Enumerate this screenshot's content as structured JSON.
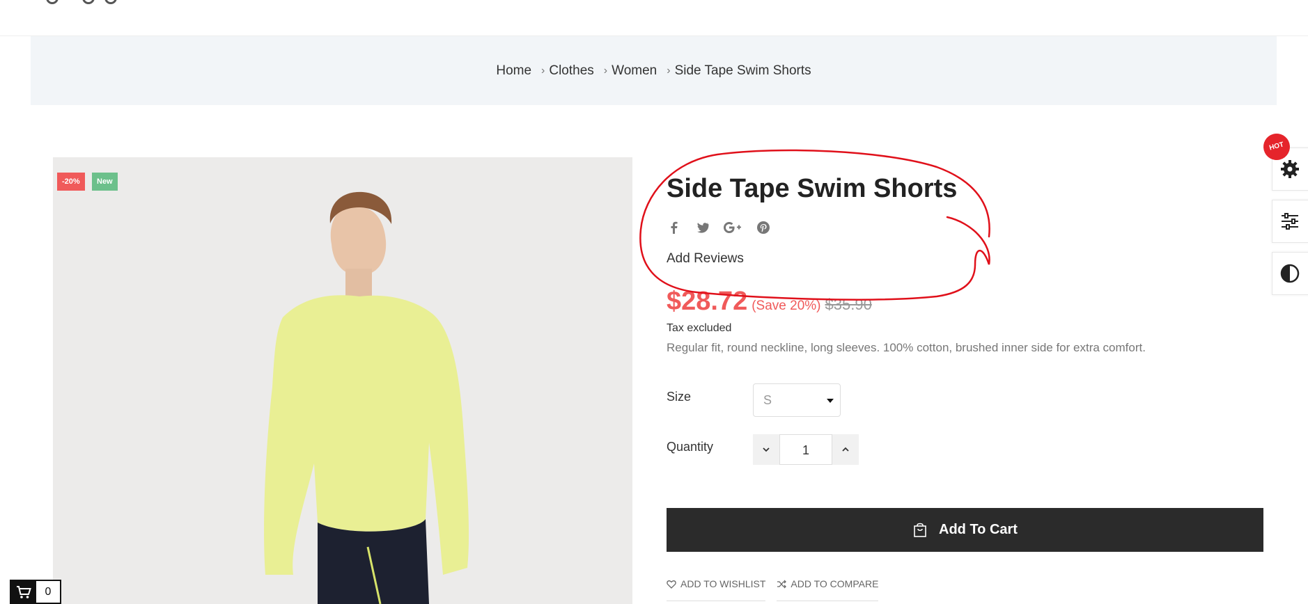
{
  "breadcrumb": {
    "items": [
      "Home",
      "Clothes",
      "Women",
      "Side Tape Swim Shorts"
    ],
    "separator": "›"
  },
  "product": {
    "badges": {
      "sale": "-20%",
      "new": "New"
    },
    "title": "Side Tape Swim Shorts",
    "social_icons": [
      "facebook-icon",
      "twitter-icon",
      "google-plus-icon",
      "pinterest-icon"
    ],
    "add_reviews": "Add Reviews",
    "price": "$28.72",
    "save": "(Save 20%)",
    "old_price": "$35.90",
    "tax": "Tax excluded",
    "description": "Regular fit, round neckline, long sleeves. 100% cotton, brushed inner side for extra comfort."
  },
  "options": {
    "size_label": "Size",
    "size_value": "S",
    "quantity_label": "Quantity",
    "quantity_value": "1"
  },
  "actions": {
    "add_to_cart": "Add To Cart",
    "add_to_wishlist": "ADD TO WISHLIST",
    "add_to_compare": "ADD TO COMPARE"
  },
  "side_tools": {
    "hot_badge": "HOT",
    "icons": [
      "gear-icon",
      "sliders-icon",
      "contrast-icon"
    ]
  },
  "mini_cart": {
    "count": "0"
  },
  "colors": {
    "accent": "#f05a5a",
    "new_badge": "#6cc08b",
    "cart_button": "#2b2b2b",
    "annotation": "#e0101a",
    "hot": "#e5242b"
  }
}
